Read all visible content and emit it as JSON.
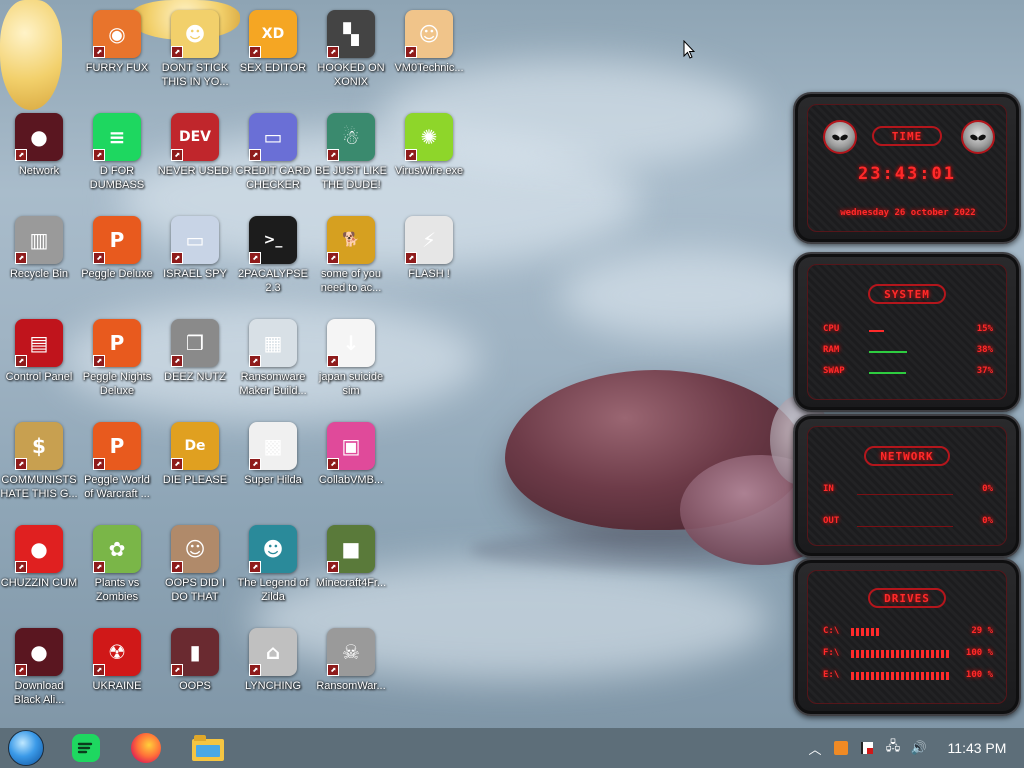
{
  "desktop": {
    "icons": [
      {
        "id": "furry-fux",
        "label": "FURRY FUX",
        "color": "#e8742c",
        "glyph": "◉",
        "col": 1,
        "row": 0
      },
      {
        "id": "dont-stick",
        "label": "DONT STICK THIS IN YO...",
        "color": "#f2d06b",
        "glyph": "☻",
        "col": 2,
        "row": 0
      },
      {
        "id": "sex-editor",
        "label": "SEX EDITOR",
        "color": "#f5a623",
        "glyph": "XD",
        "col": 3,
        "row": 0
      },
      {
        "id": "hooked-on-xonix",
        "label": "HOOKED ON XONIX",
        "color": "#444444",
        "glyph": "▚",
        "col": 4,
        "row": 0
      },
      {
        "id": "vm0technic",
        "label": "VM0Technic...",
        "color": "#f0c48a",
        "glyph": "☺",
        "col": 5,
        "row": 0
      },
      {
        "id": "network",
        "label": "Network",
        "color": "#5a1620",
        "glyph": "●",
        "col": 0,
        "row": 1
      },
      {
        "id": "d-for-dumbass",
        "label": "D FOR DUMBASS",
        "color": "#1ed760",
        "glyph": "≡",
        "col": 1,
        "row": 1
      },
      {
        "id": "never-used",
        "label": "NEVER USED!",
        "color": "#c0262c",
        "glyph": "DEV",
        "col": 2,
        "row": 1
      },
      {
        "id": "credit-card-checker",
        "label": "CREDIT CARD CHECKER",
        "color": "#6a6fd6",
        "glyph": "▭",
        "col": 3,
        "row": 1
      },
      {
        "id": "be-just-like",
        "label": "BE JUST LIKE THE DUDE!",
        "color": "#3a8a6e",
        "glyph": "☃",
        "col": 4,
        "row": 1
      },
      {
        "id": "viruswire",
        "label": "VirusWire.exe",
        "color": "#8ed62a",
        "glyph": "✺",
        "col": 5,
        "row": 1
      },
      {
        "id": "recycle-bin",
        "label": "Recycle Bin",
        "color": "#9a9a9a",
        "glyph": "▥",
        "col": 0,
        "row": 2
      },
      {
        "id": "peggle-deluxe",
        "label": "Peggle Deluxe",
        "color": "#e85a1e",
        "glyph": "P",
        "col": 1,
        "row": 2
      },
      {
        "id": "israel-spy",
        "label": "ISRAEL SPY",
        "color": "#c8d4e6",
        "glyph": "▭",
        "col": 2,
        "row": 2
      },
      {
        "id": "2pacalypse",
        "label": "2PACALYPSE 2.3",
        "color": "#1c1c1c",
        "glyph": ">_",
        "col": 3,
        "row": 2
      },
      {
        "id": "some-of-you",
        "label": "some of you need to ac...",
        "color": "#d6a020",
        "glyph": "🐕",
        "col": 4,
        "row": 2
      },
      {
        "id": "flash",
        "label": "FLASH !",
        "color": "#e6e6e6",
        "glyph": "⚡",
        "col": 5,
        "row": 2
      },
      {
        "id": "control-panel",
        "label": "Control Panel",
        "color": "#c0141c",
        "glyph": "▤",
        "col": 0,
        "row": 3
      },
      {
        "id": "peggle-nights",
        "label": "Peggle Nights Deluxe",
        "color": "#e85a1e",
        "glyph": "P",
        "col": 1,
        "row": 3
      },
      {
        "id": "deez-nutz",
        "label": "DEEZ NUTZ",
        "color": "#8a8a8a",
        "glyph": "❒",
        "col": 2,
        "row": 3
      },
      {
        "id": "ransomware-maker",
        "label": "Ransomware Maker Build...",
        "color": "#d8e0e6",
        "glyph": "▦",
        "col": 3,
        "row": 3
      },
      {
        "id": "japan-suicide",
        "label": "japan suicide sim",
        "color": "#f5f5f5",
        "glyph": "↓",
        "col": 4,
        "row": 3
      },
      {
        "id": "communists",
        "label": "COMMUNISTS HATE THIS G...",
        "color": "#c8a050",
        "glyph": "$",
        "col": 0,
        "row": 4
      },
      {
        "id": "peggle-world",
        "label": "Peggle World of Warcraft ...",
        "color": "#e85a1e",
        "glyph": "P",
        "col": 1,
        "row": 4
      },
      {
        "id": "die-please",
        "label": "DIE PLEASE",
        "color": "#e0a020",
        "glyph": "De",
        "col": 2,
        "row": 4
      },
      {
        "id": "super-hilda",
        "label": "Super Hilda",
        "color": "#f0f0f0",
        "glyph": "▩",
        "col": 3,
        "row": 4
      },
      {
        "id": "collabvm",
        "label": "CollabVMB...",
        "color": "#e04a9a",
        "glyph": "▣",
        "col": 4,
        "row": 4
      },
      {
        "id": "chuzzin-cum",
        "label": "CHUZZIN CUM",
        "color": "#e02020",
        "glyph": "●",
        "col": 0,
        "row": 5
      },
      {
        "id": "plants-vs-zombies",
        "label": "Plants vs Zombies",
        "color": "#7ab648",
        "glyph": "✿",
        "col": 1,
        "row": 5
      },
      {
        "id": "oops-did-i",
        "label": "OOPS DID I DO THAT",
        "color": "#b08a6a",
        "glyph": "☺",
        "col": 2,
        "row": 5
      },
      {
        "id": "legend-of-zilda",
        "label": "The Legend of Zilda",
        "color": "#2a8a9a",
        "glyph": "☻",
        "col": 3,
        "row": 5
      },
      {
        "id": "minecraft",
        "label": "Minecraft4Fr...",
        "color": "#5a7a3a",
        "glyph": "■",
        "col": 4,
        "row": 5
      },
      {
        "id": "download-black",
        "label": "Download Black Ali...",
        "color": "#5a1620",
        "glyph": "●",
        "col": 0,
        "row": 6
      },
      {
        "id": "ukraine",
        "label": "UKRAINE",
        "color": "#d01818",
        "glyph": "☢",
        "col": 1,
        "row": 6
      },
      {
        "id": "oops",
        "label": "OOPS",
        "color": "#6a2a30",
        "glyph": "▮",
        "col": 2,
        "row": 6
      },
      {
        "id": "lynching",
        "label": "LYNCHING",
        "color": "#c0c0c0",
        "glyph": "⌂",
        "col": 3,
        "row": 6
      },
      {
        "id": "ransomwar",
        "label": "RansomWar...",
        "color": "#9a9a9a",
        "glyph": "☠",
        "col": 4,
        "row": 6
      }
    ]
  },
  "gadget": {
    "time_title": "TIME",
    "time": "23:43:01",
    "date": "wednesday 26 october 2022",
    "system_title": "SYSTEM",
    "system": [
      {
        "label": "CPU",
        "value": "15%",
        "fraction": 0.15
      },
      {
        "label": "RAM",
        "value": "38%",
        "fraction": 0.38
      },
      {
        "label": "SWAP",
        "value": "37%",
        "fraction": 0.37
      }
    ],
    "network_title": "NETWORK",
    "network": [
      {
        "label": "IN",
        "value": "0%"
      },
      {
        "label": "OUT",
        "value": "0%"
      }
    ],
    "drives_title": "DRIVES",
    "drives": [
      {
        "label": "C:\\",
        "value": "29 %",
        "fraction": 0.29
      },
      {
        "label": "F:\\",
        "value": "100 %",
        "fraction": 1.0
      },
      {
        "label": "E:\\",
        "value": "100 %",
        "fraction": 1.0
      }
    ]
  },
  "taskbar": {
    "clock": "11:43 PM",
    "start_icon": "start-orb",
    "pinned": [
      "spotify-icon",
      "firefox-icon",
      "file-explorer-icon"
    ],
    "tray": [
      "chevron-up-icon",
      "app-tray-icon",
      "flag-icon",
      "network-icon",
      "volume-icon"
    ]
  }
}
